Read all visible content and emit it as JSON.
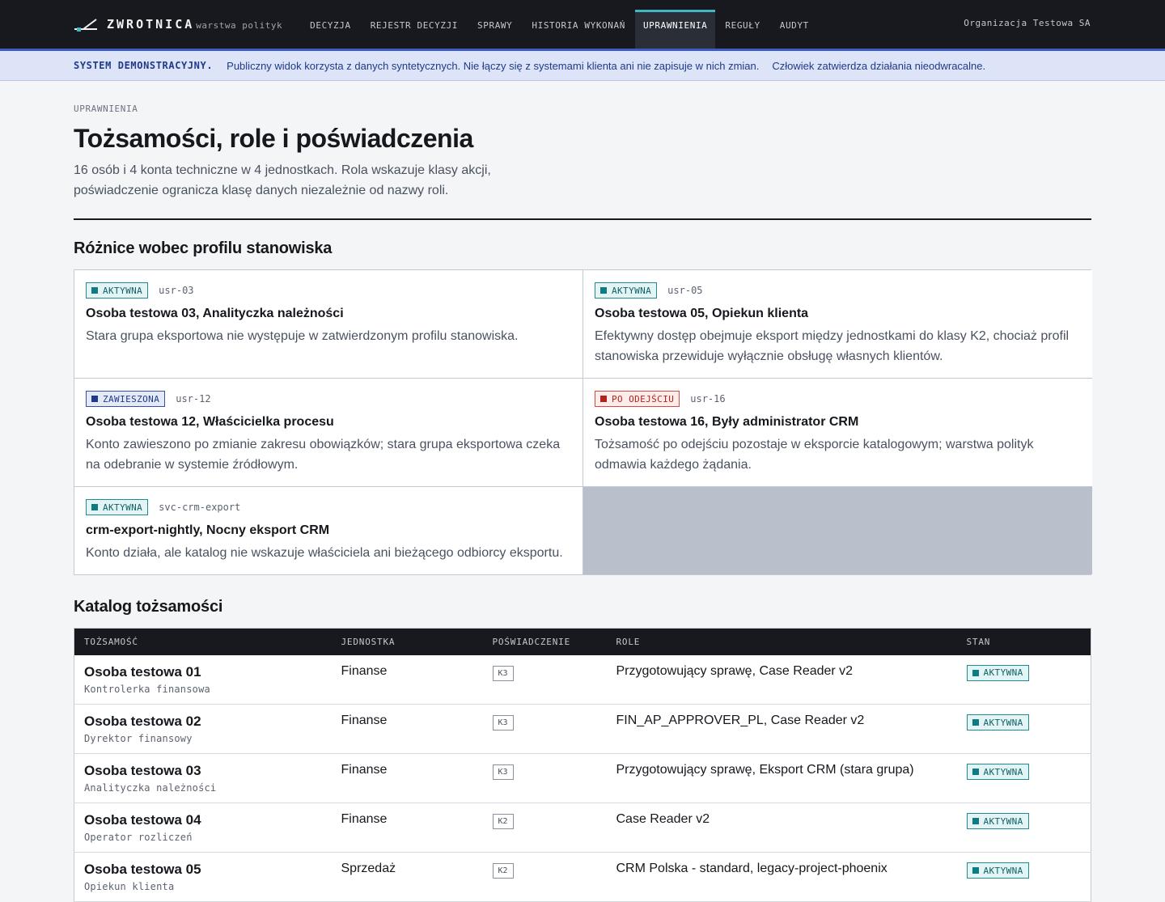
{
  "app": {
    "name": "ZWROTNICA",
    "subtitle": "warstwa polityk",
    "org": "Organizacja Testowa SA"
  },
  "nav": {
    "items": [
      {
        "label": "DECYZJA",
        "active": false
      },
      {
        "label": "REJESTR DECYZJI",
        "active": false
      },
      {
        "label": "SPRAWY",
        "active": false
      },
      {
        "label": "HISTORIA WYKONAŃ",
        "active": false
      },
      {
        "label": "UPRAWNIENIA",
        "active": true
      },
      {
        "label": "REGUŁY",
        "active": false
      },
      {
        "label": "AUDYT",
        "active": false
      }
    ]
  },
  "banner": {
    "tag": "SYSTEM DEMONSTRACYJNY.",
    "text": "Publiczny widok korzysta z danych syntetycznych. Nie łączy się z systemami klienta ani nie zapisuje w nich zmian.",
    "text2": "Człowiek zatwierdza działania nieodwracalne."
  },
  "page": {
    "eyebrow": "UPRAWNIENIA",
    "title": "Tożsamości, role i poświadczenia",
    "lead": "16 osób i 4 konta techniczne w 4 jednostkach. Rola wskazuje klasy akcji, poświadczenie ogranicza klasę danych niezależnie od nazwy roli."
  },
  "diff": {
    "heading": "Różnice wobec profilu stanowiska",
    "cards": [
      {
        "status": "AKTYWNA",
        "status_kind": "active",
        "id": "usr-03",
        "title": "Osoba testowa 03, Analityczka należności",
        "desc": "Stara grupa eksportowa nie występuje w zatwierdzonym profilu stanowiska."
      },
      {
        "status": "AKTYWNA",
        "status_kind": "active",
        "id": "usr-05",
        "title": "Osoba testowa 05, Opiekun klienta",
        "desc": "Efektywny dostęp obejmuje eksport między jednostkami do klasy K2, chociaż profil stanowiska przewiduje wyłącznie obsługę własnych klientów."
      },
      {
        "status": "ZAWIESZONA",
        "status_kind": "susp",
        "id": "usr-12",
        "title": "Osoba testowa 12, Właścicielka procesu",
        "desc": "Konto zawieszono po zmianie zakresu obowiązków; stara grupa eksportowa czeka na odebranie w systemie źródłowym."
      },
      {
        "status": "PO ODEJŚCIU",
        "status_kind": "left",
        "id": "usr-16",
        "title": "Osoba testowa 16, Były administrator CRM",
        "desc": "Tożsamość po odejściu pozostaje w eksporcie katalogowym; warstwa polityk odmawia każdego żądania."
      },
      {
        "status": "AKTYWNA",
        "status_kind": "active",
        "id": "svc-crm-export",
        "title": "crm-export-nightly, Nocny eksport CRM",
        "desc": "Konto działa, ale katalog nie wskazuje właściciela ani bieżącego odbiorcy eksportu."
      }
    ]
  },
  "catalog": {
    "heading": "Katalog tożsamości",
    "columns": [
      "TOŻSAMOŚĆ",
      "JEDNOSTKA",
      "POŚWIADCZENIE",
      "ROLE",
      "STAN"
    ],
    "rows": [
      {
        "name": "Osoba testowa 01",
        "position": "Kontrolerka finansowa",
        "unit": "Finanse",
        "cred": "K3",
        "roles": "Przygotowujący sprawę, Case Reader v2",
        "state": "AKTYWNA"
      },
      {
        "name": "Osoba testowa 02",
        "position": "Dyrektor finansowy",
        "unit": "Finanse",
        "cred": "K3",
        "roles": "FIN_AP_APPROVER_PL, Case Reader v2",
        "state": "AKTYWNA"
      },
      {
        "name": "Osoba testowa 03",
        "position": "Analityczka należności",
        "unit": "Finanse",
        "cred": "K3",
        "roles": "Przygotowujący sprawę, Eksport CRM (stara grupa)",
        "state": "AKTYWNA"
      },
      {
        "name": "Osoba testowa 04",
        "position": "Operator rozliczeń",
        "unit": "Finanse",
        "cred": "K2",
        "roles": "Case Reader v2",
        "state": "AKTYWNA"
      },
      {
        "name": "Osoba testowa 05",
        "position": "Opiekun klienta",
        "unit": "Sprzedaż",
        "cred": "K2",
        "roles": "CRM Polska - standard, legacy-project-phoenix",
        "state": "AKTYWNA"
      }
    ]
  }
}
